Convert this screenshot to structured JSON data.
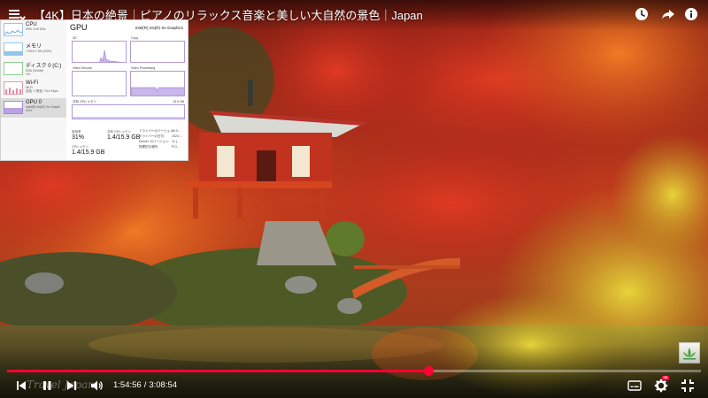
{
  "header": {
    "title": "【4K】日本の絶景｜ピアノのリラックス音楽と美しい大自然の景色｜Japan"
  },
  "icons": {
    "menu": "hamburger-menu-icon",
    "watch_later": "clock-icon",
    "share": "share-arrow-icon",
    "info": "info-icon",
    "prev": "skip-previous-icon",
    "pause": "pause-icon",
    "next": "skip-next-icon",
    "volume": "volume-icon",
    "subtitles": "subtitles-icon",
    "settings": "gear-icon",
    "fullscreen": "exit-fullscreen-icon"
  },
  "player": {
    "current_time": "1:54:56",
    "separator": "/",
    "duration": "3:08:54",
    "progress": 0.607,
    "settings_badge": "HD",
    "watermark": "Travel Japan",
    "accent_color": "#ff0033"
  },
  "task_manager": {
    "sidebar": [
      {
        "name": "CPU",
        "sub": "29%  3.49 GHz",
        "active": false
      },
      {
        "name": "メモリ",
        "sub": "7.5/15.7 GB (23%)",
        "active": false
      },
      {
        "name": "ディスク 0 (C:)",
        "sub": "SSD (NVMe)\n1%",
        "active": false
      },
      {
        "name": "Wi-Fi",
        "sub": "Wi-Fi\n送信: 0 受信: 76.4 Kbps",
        "active": false
      },
      {
        "name": "GPU 0",
        "sub": "Intel(R) Iris(R) Xe Graphi\n31%",
        "active": true
      }
    ],
    "gpu_title": "GPU",
    "gpu_model": "Intel(R) Iris(R) Xe Graphics",
    "graphs": [
      {
        "label": "3D"
      },
      {
        "label": "Copy"
      },
      {
        "label": "Video Decode"
      },
      {
        "label": "Video Processing"
      }
    ],
    "shared_memory_label": "共有 GPU メモリ",
    "shared_memory_max": "15.9 GB",
    "stats": [
      {
        "label": "使用率",
        "value": "31%"
      },
      {
        "label": "共有 GPU メモリ",
        "value": "1.4/15.9 GB"
      },
      {
        "label": "GPU メモリ",
        "value": "1.4/15.9 GB"
      }
    ],
    "details": [
      {
        "label": "ドライバーのバージョン:",
        "value": "30.0..."
      },
      {
        "label": "ドライバーの日付:",
        "value": "2021/..."
      },
      {
        "label": "DirectX のバージョン:",
        "value": "12 (..."
      },
      {
        "label": "物理的な場所:",
        "value": "PCI..."
      }
    ]
  }
}
